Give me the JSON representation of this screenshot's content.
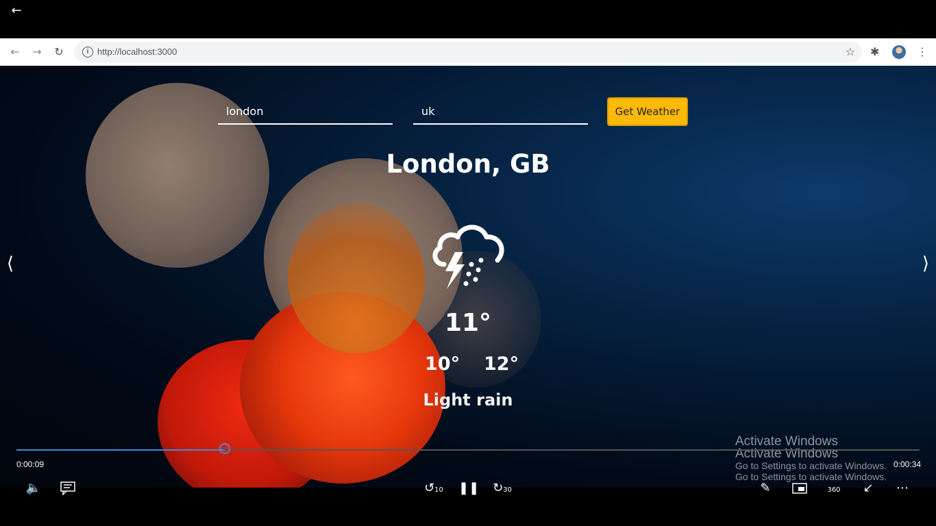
{
  "player": {
    "back_icon": "arrow-left-icon",
    "current_time": "0:00:09",
    "total_time": "0:00:34",
    "progress_fraction": 0.231,
    "accent_color": "#3b8edb",
    "controls": {
      "rewind_label": "10",
      "forward_label": "30",
      "view360_label": "360"
    }
  },
  "browser": {
    "url": "http://localhost:3000"
  },
  "app": {
    "city_value": "london",
    "country_value": "uk",
    "button_label": "Get Weather",
    "button_color": "#ffba08",
    "location": "London, GB",
    "icon": "thunderstorm-rain-icon",
    "temp": "11°",
    "temp_min": "10°",
    "temp_max": "12°",
    "description": "Light rain"
  },
  "watermark": {
    "title": "Activate Windows",
    "subtitle": "Go to Settings to activate Windows."
  }
}
